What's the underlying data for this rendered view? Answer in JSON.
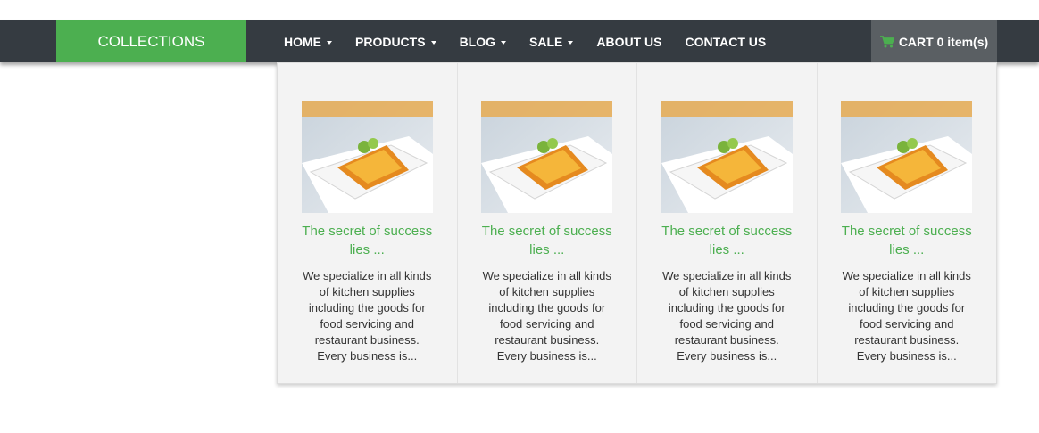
{
  "brand": {
    "label": "COLLECTIONS",
    "color": "#4caf50"
  },
  "nav": {
    "items": [
      {
        "label": "HOME",
        "has_dropdown": true
      },
      {
        "label": "PRODUCTS",
        "has_dropdown": true
      },
      {
        "label": "BLOG",
        "has_dropdown": true
      },
      {
        "label": "SALE",
        "has_dropdown": true
      },
      {
        "label": "ABOUT US",
        "has_dropdown": false
      },
      {
        "label": "CONTACT US",
        "has_dropdown": false
      }
    ],
    "background": "#353b41"
  },
  "cart": {
    "label": "CART 0 item(s)",
    "icon": "shopping-cart-icon"
  },
  "mega_menu": {
    "items": [
      {
        "title": "The secret of success lies ...",
        "description": "We specialize in all kinds of kitchen supplies including the goods for food servicing and restaurant business. Every business is..."
      },
      {
        "title": "The secret of success lies ...",
        "description": "We specialize in all kinds of kitchen supplies including the goods for food servicing and restaurant business. Every business is..."
      },
      {
        "title": "The secret of success lies ...",
        "description": "We specialize in all kinds of kitchen supplies including the goods for food servicing and restaurant business. Every business is..."
      },
      {
        "title": "The secret of success lies ...",
        "description": "We specialize in all kinds of kitchen supplies including the goods for food servicing and restaurant business. Every business is..."
      }
    ]
  }
}
